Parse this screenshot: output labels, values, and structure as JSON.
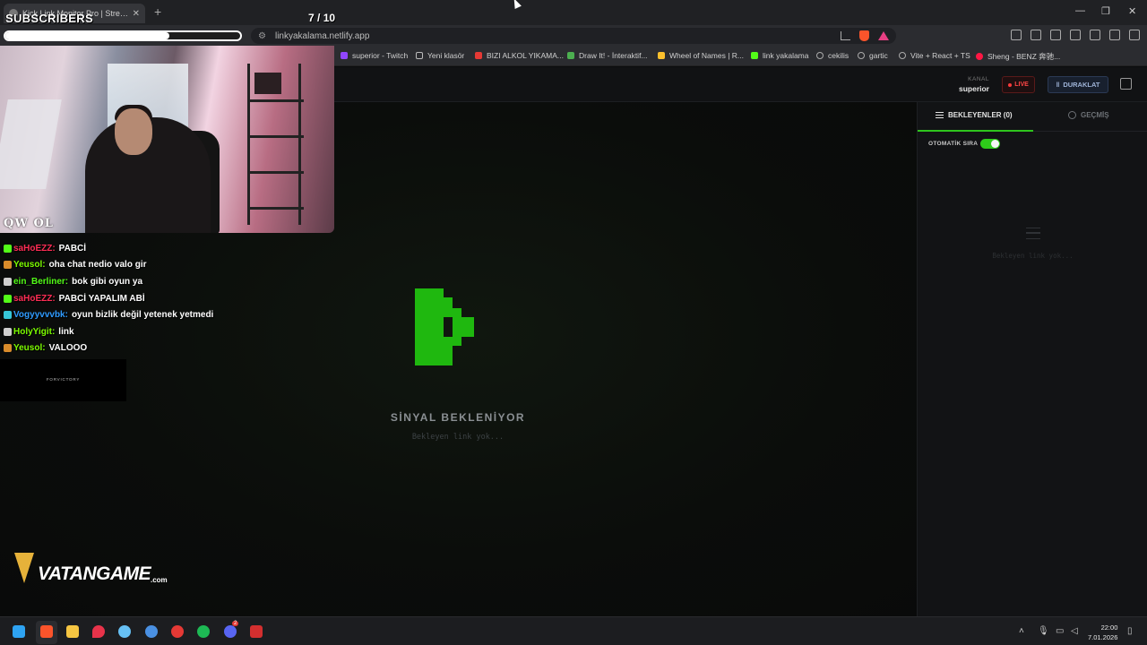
{
  "browser": {
    "tab_title": "Kick Link Monitor Pro | Stream D",
    "tab_close": "✕",
    "new_tab": "+",
    "url": "linkyakalama.netlify.app",
    "window_controls": {
      "minimize": "—",
      "restore": "❐",
      "close": "✕"
    }
  },
  "bookmarks": [
    {
      "label": "superior - Twitch",
      "color": "#9146ff"
    },
    {
      "label": "Yeni klasör",
      "color": "#999999"
    },
    {
      "label": "BIZI ALKOL YIKAMA...",
      "color": "#e53935"
    },
    {
      "label": "Draw It! - İnteraktif...",
      "color": "#4caf50"
    },
    {
      "label": "Wheel of Names | R...",
      "color": "#fbc02d"
    },
    {
      "label": "link yakalama",
      "color": "#53fc18"
    },
    {
      "label": "cekilis",
      "color": "#aaaaaa"
    },
    {
      "label": "gartic",
      "color": "#aaaaaa"
    },
    {
      "label": "Vite + React + TS",
      "color": "#aaaaaa"
    },
    {
      "label": "Sheng - BENZ 奔驰...",
      "color": "#ff1744"
    }
  ],
  "app": {
    "channel_label": "KANAL",
    "channel_name": "superior",
    "live_label": "LIVE",
    "pause_label": "DURAKLAT",
    "signal_title": "SİNYAL BEKLENİYOR",
    "signal_sub": "Bekleyen link yok...",
    "panel": {
      "tab_pending": "BEKLEYENLER (0)",
      "tab_history": "GEÇMİŞ",
      "auto_queue_label": "OTOMATİK SIRA",
      "auto_queue_on": true,
      "empty_text": "Bekleyen link yok..."
    },
    "accent": "#2ec41d"
  },
  "overlay": {
    "subscribers_label": "SUBSCRIBERS",
    "goal_current": "7",
    "goal_total": "/ 10",
    "goal_progress": 0.7,
    "cam_tag": "QW OL",
    "forvictory": "FORVICTORY",
    "sponsor_word": "VATANGAME",
    "sponsor_tld": ".com"
  },
  "chat": [
    {
      "user": "saHoEZZ:",
      "text": "PABCİ",
      "color": "#ff2d55",
      "badge": "#53fc18"
    },
    {
      "user": "Yeusol:",
      "text": "oha chat nedio valo gir",
      "color": "#7cfc00",
      "badge": "#d98c2b"
    },
    {
      "user": "ein_Berliner:",
      "text": "bok gibi oyun ya",
      "color": "#53fc18",
      "badge": "#cfcfcf"
    },
    {
      "user": "saHoEZZ:",
      "text": "PABCİ YAPALIM ABİ",
      "color": "#ff2d55",
      "badge": "#53fc18"
    },
    {
      "user": "Vogyyvvvbk:",
      "text": "oyun bizlik değil yetenek yetmedi",
      "color": "#2f9bff",
      "badge": "#36c6d8"
    },
    {
      "user": "HolyYigit:",
      "text": "link",
      "color": "#7cfc00",
      "badge": "#cfcfcf"
    },
    {
      "user": "Yeusol:",
      "text": "VALOOO",
      "color": "#7cfc00",
      "badge": "#d98c2b"
    }
  ],
  "taskbar": {
    "time": "22:00",
    "date": "7.01.2026",
    "apps": [
      {
        "name": "windows-start-icon",
        "color": "#2ea3f2"
      },
      {
        "name": "brave-browser-icon",
        "color": "#fb542b"
      },
      {
        "name": "file-explorer-icon",
        "color": "#f5c542"
      },
      {
        "name": "maps-pin-icon",
        "color": "#e8334a"
      },
      {
        "name": "steam-icon",
        "color": "#66c0f4"
      },
      {
        "name": "water-drop-icon",
        "color": "#4a90e2"
      },
      {
        "name": "red-app-icon",
        "color": "#e53935"
      },
      {
        "name": "spotify-icon",
        "color": "#1db954"
      },
      {
        "name": "discord-icon",
        "color": "#5865f2"
      },
      {
        "name": "media-app-icon",
        "color": "#d32f2f"
      }
    ],
    "discord_badge": "2"
  }
}
